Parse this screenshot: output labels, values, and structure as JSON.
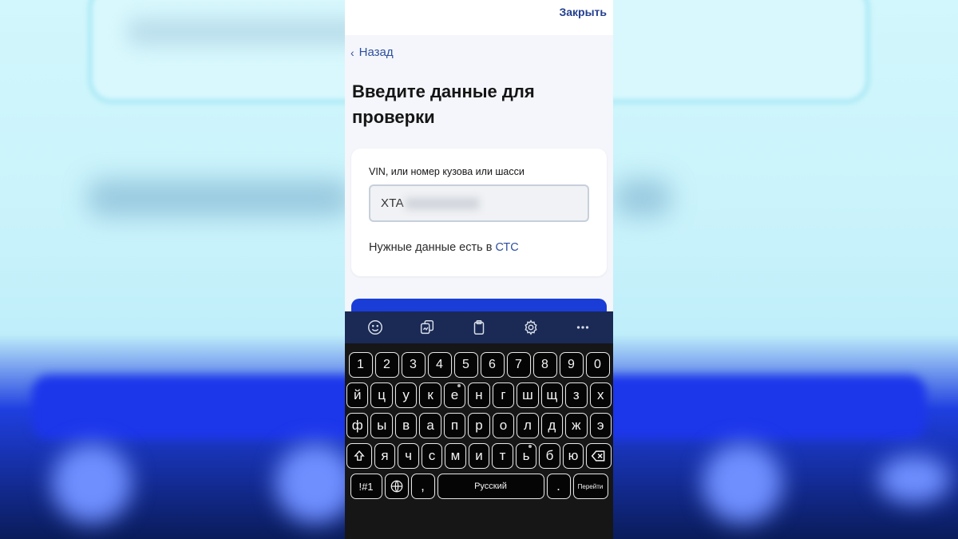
{
  "header": {
    "close_label": "Закрыть"
  },
  "nav": {
    "back_label": "Назад"
  },
  "page": {
    "title": "Введите данные для проверки",
    "field_label": "VIN, или номер кузова или шасси",
    "field_value": "XTA",
    "hint_text": "Нужные данные есть в",
    "hint_link": "СТС"
  },
  "keyboard": {
    "toolbar_icons": [
      "emoji-icon",
      "sticker-icon",
      "clipboard-icon",
      "settings-icon",
      "more-icon"
    ],
    "row_numbers": [
      "1",
      "2",
      "3",
      "4",
      "5",
      "6",
      "7",
      "8",
      "9",
      "0"
    ],
    "row1": [
      "й",
      "ц",
      "у",
      "к",
      "е",
      "н",
      "г",
      "ш",
      "щ",
      "з",
      "х"
    ],
    "row2": [
      "ф",
      "ы",
      "в",
      "а",
      "п",
      "р",
      "о",
      "л",
      "д",
      "ж",
      "э"
    ],
    "row3": [
      "я",
      "ч",
      "с",
      "м",
      "и",
      "т",
      "ь",
      "б",
      "ю"
    ],
    "symbols_label": "!#1",
    "comma_label": ",",
    "space_label": "Русский",
    "period_label": ".",
    "enter_label": "Перейти"
  }
}
